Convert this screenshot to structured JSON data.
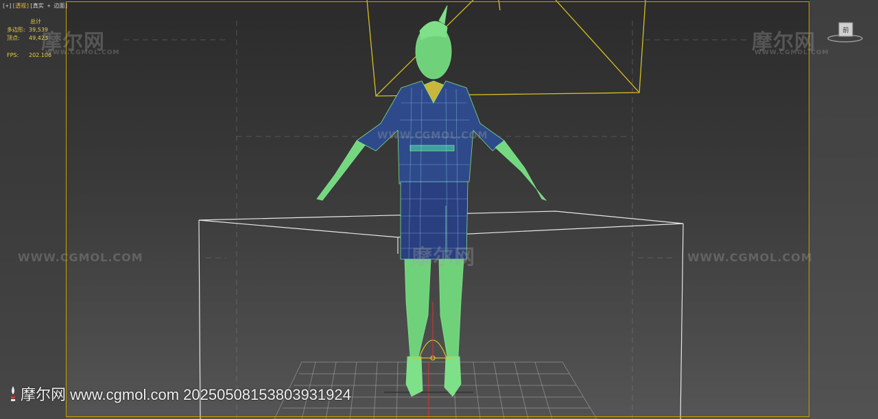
{
  "viewport": {
    "label_plus": "[+]",
    "label_view": "[透视]",
    "label_shading": "[真实 + 边面]"
  },
  "stats": {
    "title": "总计",
    "polygons_label": "多边形:",
    "polygons_value": "39,539",
    "vertices_label": "顶点:",
    "vertices_value": "49,423",
    "fps_label": "FPS:",
    "fps_value": "202.106"
  },
  "viewcube": {
    "face_label": "前"
  },
  "watermarks": {
    "logo_cn": "摩尔网",
    "logo_en": "WWW.CGMOL.COM",
    "site_en": "WWW.CGMOL.COM"
  },
  "bottom_watermark": {
    "text": "摩尔网 www.cgmol.com 20250508153803931924"
  },
  "colors": {
    "accent_yellow": "#e8d040",
    "selection_yellow": "#c8a000",
    "wire_green": "#7fe08a",
    "mesh_blue": "#2a3f80"
  }
}
